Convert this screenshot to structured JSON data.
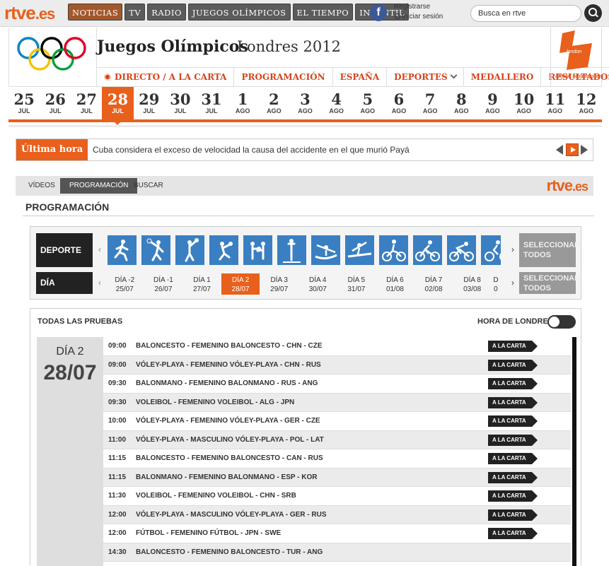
{
  "topbar": {
    "logo": "rtve",
    "logo_suffix": ".es",
    "nav": [
      "NOTICIAS",
      "TV",
      "RADIO",
      "JUEGOS OLÍMPICOS",
      "EL TIEMPO",
      "INFANTIL"
    ],
    "facebook_letter": "f",
    "register": "Registrarse",
    "login": "Iniciar sesión",
    "search_placeholder": "Busca en rtve"
  },
  "header": {
    "title": "Juegos Olímpicos",
    "subtitle": "Londres 2012",
    "nav": [
      "DIRECTO / A LA CARTA",
      "PROGRAMACIÓN",
      "ESPAÑA",
      "DEPORTES",
      "MEDALLERO",
      "RESULTADOS"
    ],
    "london_logo_text": "london",
    "broadcaster": "official broadcaster",
    "ring_colors": [
      "#0085c7",
      "#000000",
      "#df0024",
      "#f4c300",
      "#009f3d"
    ],
    "accent": "#e8601c"
  },
  "dates": [
    {
      "n": "25",
      "m": "JUL"
    },
    {
      "n": "26",
      "m": "JUL"
    },
    {
      "n": "27",
      "m": "JUL"
    },
    {
      "n": "28",
      "m": "JUL",
      "selected": true
    },
    {
      "n": "29",
      "m": "JUL"
    },
    {
      "n": "30",
      "m": "JUL"
    },
    {
      "n": "31",
      "m": "JUL"
    },
    {
      "n": "1",
      "m": "AGO"
    },
    {
      "n": "2",
      "m": "AGO"
    },
    {
      "n": "3",
      "m": "AGO"
    },
    {
      "n": "4",
      "m": "AGO"
    },
    {
      "n": "5",
      "m": "AGO"
    },
    {
      "n": "6",
      "m": "AGO"
    },
    {
      "n": "7",
      "m": "AGO"
    },
    {
      "n": "8",
      "m": "AGO"
    },
    {
      "n": "9",
      "m": "AGO"
    },
    {
      "n": "10",
      "m": "AGO"
    },
    {
      "n": "11",
      "m": "AGO"
    },
    {
      "n": "12",
      "m": "AGO"
    }
  ],
  "breaking": {
    "label": "Última hora",
    "text": "Cuba considera el exceso de velocidad la causa del accidente en el que murió Payá"
  },
  "tabs": [
    {
      "label": "VÍDEOS"
    },
    {
      "label": "PROGRAMACIÓN",
      "selected": true
    },
    {
      "label": "BUSCAR"
    }
  ],
  "tabs_logo": "rtve",
  "tabs_logo_suffix": ".es",
  "page_title": "PROGRAMACIÓN",
  "filters": {
    "sport_label": "DEPORTE",
    "day_label": "DÍA",
    "select_all": "SELECCIONAR TODOS",
    "sport_icons": [
      "athletics-icon",
      "badminton-icon",
      "basketball-icon",
      "handball-icon",
      "boxing-icon",
      "diving-icon",
      "canoe-slalom-icon",
      "canoe-sprint-icon",
      "bmx-icon",
      "mountain-bike-icon",
      "cycling-road-icon",
      "cycling-track-icon"
    ],
    "days": [
      {
        "l1": "DÍA -2",
        "l2": "25/07"
      },
      {
        "l1": "DÍA -1",
        "l2": "26/07"
      },
      {
        "l1": "DÍA 1",
        "l2": "27/07"
      },
      {
        "l1": "DÍA 2",
        "l2": "28/07",
        "selected": true
      },
      {
        "l1": "DÍA 3",
        "l2": "29/07"
      },
      {
        "l1": "DÍA 4",
        "l2": "30/07"
      },
      {
        "l1": "DÍA 5",
        "l2": "31/07"
      },
      {
        "l1": "DÍA 6",
        "l2": "01/08"
      },
      {
        "l1": "DÍA 7",
        "l2": "02/08"
      },
      {
        "l1": "DÍA 8",
        "l2": "03/08"
      },
      {
        "l1": "D",
        "l2": "0"
      }
    ]
  },
  "schedule": {
    "header": "TODAS LAS PRUEBAS",
    "london_time": "HORA DE LONDRES",
    "day_label": "DÍA 2",
    "day_date": "28/07",
    "button_label": "A LA CARTA",
    "rows": [
      {
        "time": "09:00",
        "event": "BALONCESTO - FEMENINO BALONCESTO - CHN - CZE"
      },
      {
        "time": "09:00",
        "event": "VÓLEY-PLAYA - FEMENINO VÓLEY-PLAYA - CHN - RUS"
      },
      {
        "time": "09:30",
        "event": "BALONMANO - FEMENINO BALONMANO - RUS - ANG"
      },
      {
        "time": "09:30",
        "event": "VOLEIBOL - FEMENINO VOLEIBOL - ALG - JPN"
      },
      {
        "time": "10:00",
        "event": "VÓLEY-PLAYA - FEMENINO VÓLEY-PLAYA - GER - CZE"
      },
      {
        "time": "11:00",
        "event": "VÓLEY-PLAYA - MASCULINO VÓLEY-PLAYA - POL - LAT"
      },
      {
        "time": "11:15",
        "event": "BALONCESTO - FEMENINO BALONCESTO - CAN - RUS"
      },
      {
        "time": "11:15",
        "event": "BALONMANO - FEMENINO BALONMANO - ESP - KOR"
      },
      {
        "time": "11:30",
        "event": "VOLEIBOL - FEMENINO VOLEIBOL - CHN - SRB"
      },
      {
        "time": "12:00",
        "event": "VÓLEY-PLAYA - MASCULINO VÓLEY-PLAYA - GER - RUS"
      },
      {
        "time": "12:00",
        "event": "FÚTBOL - FEMENINO FÚTBOL - JPN - SWE"
      },
      {
        "time": "14:30",
        "event": "BALONCESTO - FEMENINO BALONCESTO - TUR - ANG"
      }
    ]
  }
}
